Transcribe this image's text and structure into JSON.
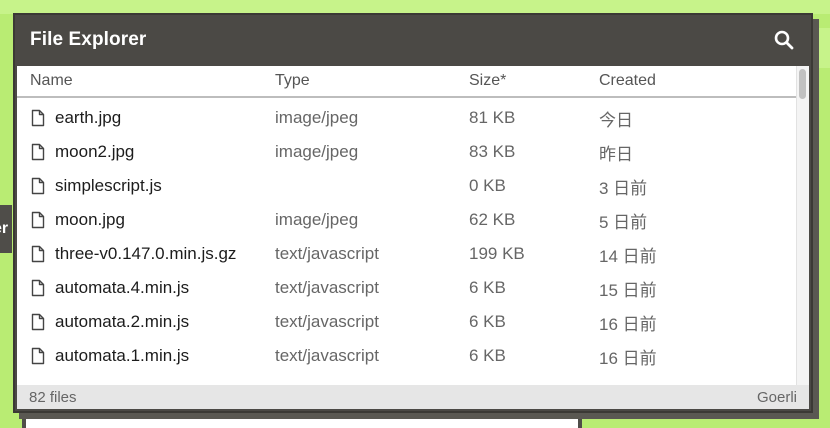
{
  "window": {
    "title": "File Explorer",
    "search_icon": "search-icon"
  },
  "table": {
    "headers": {
      "name": "Name",
      "type": "Type",
      "size": "Size*",
      "created": "Created"
    },
    "rows": [
      {
        "name": "earth.jpg",
        "type": "image/jpeg",
        "size": "81 KB",
        "created": "今日"
      },
      {
        "name": "moon2.jpg",
        "type": "image/jpeg",
        "size": "83 KB",
        "created": "昨日"
      },
      {
        "name": "simplescript.js",
        "type": "",
        "size": "0 KB",
        "created": "3 日前"
      },
      {
        "name": "moon.jpg",
        "type": "image/jpeg",
        "size": "62 KB",
        "created": "5 日前"
      },
      {
        "name": "three-v0.147.0.min.js.gz",
        "type": "text/javascript",
        "size": "199 KB",
        "created": "14 日前"
      },
      {
        "name": "automata.4.min.js",
        "type": "text/javascript",
        "size": "6 KB",
        "created": "15 日前"
      },
      {
        "name": "automata.2.min.js",
        "type": "text/javascript",
        "size": "6 KB",
        "created": "16 日前"
      },
      {
        "name": "automata.1.min.js",
        "type": "text/javascript",
        "size": "6 KB",
        "created": "16 日前"
      }
    ]
  },
  "status": {
    "count": "82 files",
    "network": "Goerli"
  },
  "background": {
    "left_tab_text": "er"
  },
  "colors": {
    "background": "#b9ec73",
    "window_frame": "#4b4945",
    "status_bar": "#e6e6e6"
  }
}
